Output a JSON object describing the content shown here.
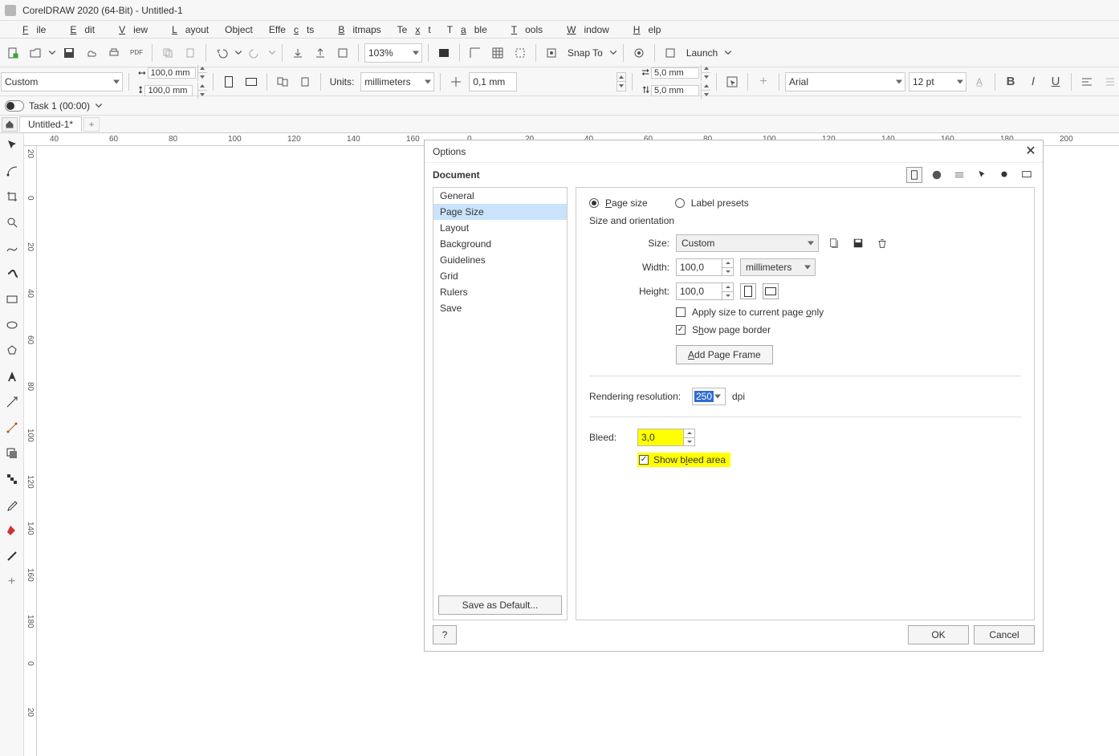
{
  "app": {
    "title": "CorelDRAW 2020 (64-Bit) - Untitled-1"
  },
  "menu": {
    "file": "File",
    "edit": "Edit",
    "view": "View",
    "layout": "Layout",
    "object": "Object",
    "effects": "Effects",
    "bitmaps": "Bitmaps",
    "text": "Text",
    "table": "Table",
    "tools": "Tools",
    "window": "Window",
    "help": "Help"
  },
  "toolbar": {
    "zoom": "103%",
    "snap": "Snap To",
    "launch": "Launch"
  },
  "props": {
    "preset": "Custom",
    "width": "100,0 mm",
    "height": "100,0 mm",
    "units_label": "Units:",
    "units": "millimeters",
    "nudge": "0,1 mm",
    "dupx": "5,0 mm",
    "dupy": "5,0 mm",
    "font": "Arial",
    "fontsize": "12 pt"
  },
  "task": {
    "rec": "Task 1 (00:00)"
  },
  "tab": {
    "name": "Untitled-1*"
  },
  "ruler": {
    "h": [
      "40",
      "60",
      "80",
      "100",
      "120",
      "140",
      "160",
      "180",
      "200",
      "0",
      "20",
      "40",
      "60",
      "80",
      "100",
      "120",
      "140",
      "160",
      "180",
      "200"
    ],
    "v": [
      "20",
      "0",
      "20",
      "40",
      "60",
      "80",
      "100",
      "120",
      "140",
      "160",
      "180",
      "0",
      "20",
      "40",
      "60",
      "80"
    ]
  },
  "dialog": {
    "title": "Options",
    "section": "Document",
    "nav": [
      "General",
      "Page Size",
      "Layout",
      "Background",
      "Guidelines",
      "Grid",
      "Rulers",
      "Save"
    ],
    "save_default": "Save as Default...",
    "page": {
      "radio_page": "Page size",
      "radio_label": "Label presets",
      "size_orient": "Size and orientation",
      "size_label": "Size:",
      "size": "Custom",
      "width_label": "Width:",
      "width": "100,0",
      "width_units": "millimeters",
      "height_label": "Height:",
      "height": "100,0",
      "apply_current": "Apply size to current page only",
      "show_border": "Show page border",
      "add_frame": "Add Page Frame",
      "res_label": "Rendering resolution:",
      "res": "250",
      "res_units": "dpi",
      "bleed_label": "Bleed:",
      "bleed": "3,0",
      "show_bleed": "Show bleed area"
    },
    "help": "?",
    "ok": "OK",
    "cancel": "Cancel"
  }
}
